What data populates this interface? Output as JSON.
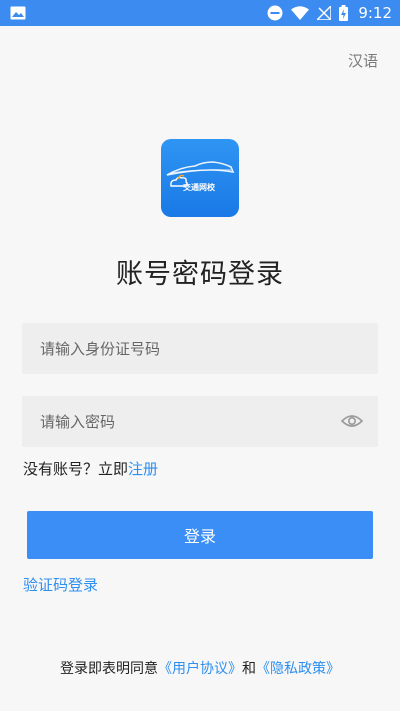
{
  "status_bar": {
    "time": "9:12"
  },
  "header": {
    "language_label": "汉语"
  },
  "app": {
    "logo_text": "交通网校"
  },
  "login": {
    "title": "账号密码登录",
    "id_placeholder": "请输入身份证号码",
    "password_placeholder": "请输入密码",
    "no_account_text": "没有账号？立即",
    "register_link": "注册",
    "login_button": "登录",
    "code_login_link": "验证码登录"
  },
  "agreement": {
    "prefix": "登录即表明同意",
    "user_agreement": "《用户协议》",
    "and": "和",
    "privacy_policy": "《隐私政策》"
  },
  "colors": {
    "accent": "#3a8ef6",
    "link": "#2d8ff0",
    "status_bar": "#3b8bf0"
  }
}
